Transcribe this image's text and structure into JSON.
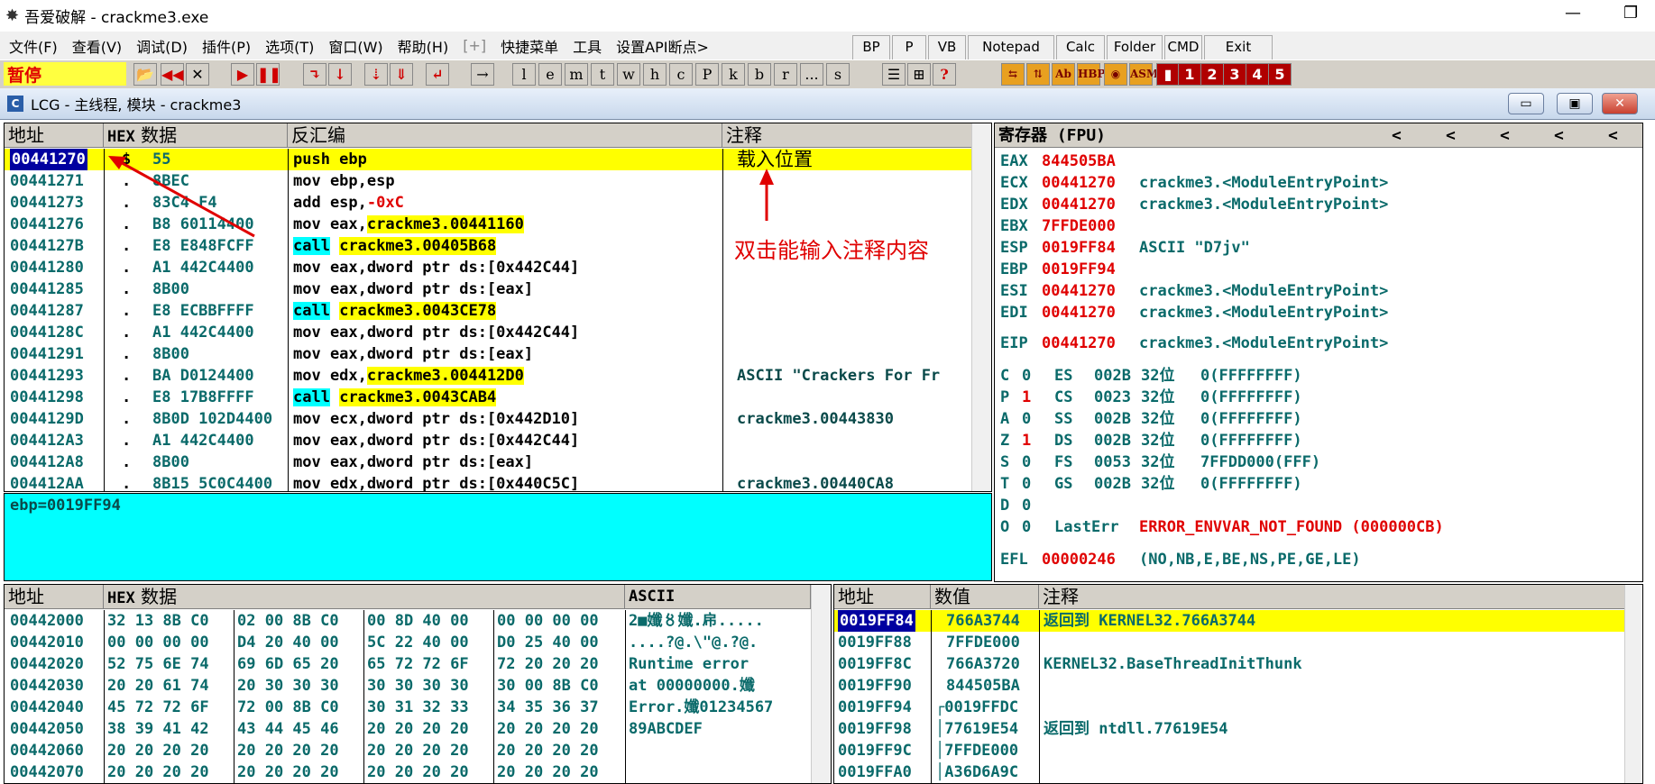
{
  "window": {
    "title": "吾爱破解 - crackme3.exe",
    "icon_name": "app-logo-icon",
    "min_label": "—",
    "restore_label": "❐"
  },
  "menu": {
    "items": [
      "文件(F)",
      "查看(V)",
      "调试(D)",
      "插件(P)",
      "选项(T)",
      "窗口(W)",
      "帮助(H)",
      "[+]",
      "快捷菜单",
      "工具",
      "设置API断点>"
    ],
    "buttons": [
      "BP",
      "P",
      "VB",
      "Notepad",
      "Calc",
      "Folder",
      "CMD",
      "Exit"
    ]
  },
  "toolbar": {
    "status": "暂停",
    "letters": [
      "l",
      "e",
      "m",
      "t",
      "w",
      "h",
      "c",
      "P",
      "k",
      "b",
      "r",
      "...",
      "s"
    ],
    "nums": [
      "1",
      "2",
      "3",
      "4",
      "5"
    ],
    "help": "?",
    "hbp": "HBP",
    "asm": "ASM"
  },
  "mdi": {
    "icon_letter": "C",
    "title": "LCG - 主线程, 模块 - crackme3",
    "min": "▭",
    "max": "▣",
    "close": "✕"
  },
  "cpu": {
    "headers": {
      "addr": "地址",
      "hex_prefix": "HEX",
      "hex": "数据",
      "disasm": "反汇编",
      "comment": "注释"
    },
    "rows": [
      {
        "addr": "00441270",
        "mark": "$",
        "hex": "55",
        "asm": "push ebp",
        "comment": "载入位置"
      },
      {
        "addr": "00441271",
        "mark": ".",
        "hex": "8BEC",
        "asm": "mov ebp,esp",
        "comment": ""
      },
      {
        "addr": "00441273",
        "mark": ".",
        "hex": "83C4 F4",
        "asm": "add esp,",
        "asm_hl": "-0xC",
        "comment": ""
      },
      {
        "addr": "00441276",
        "mark": ".",
        "hex": "B8 60114400",
        "asm": "mov eax,",
        "asm_hl": "crackme3.00441160",
        "comment": ""
      },
      {
        "addr": "0044127B",
        "mark": ".",
        "hex": "E8 E848FCFF",
        "asm": "call",
        "asm_hl": "crackme3.00405B68",
        "comment": ""
      },
      {
        "addr": "00441280",
        "mark": ".",
        "hex": "A1 442C4400",
        "asm": "mov eax,dword ptr ds:[0x442C44]",
        "comment": ""
      },
      {
        "addr": "00441285",
        "mark": ".",
        "hex": "8B00",
        "asm": "mov eax,dword ptr ds:[eax]",
        "comment": ""
      },
      {
        "addr": "00441287",
        "mark": ".",
        "hex": "E8 ECBBFFFF",
        "asm": "call",
        "asm_hl": "crackme3.0043CE78",
        "comment": ""
      },
      {
        "addr": "0044128C",
        "mark": ".",
        "hex": "A1 442C4400",
        "asm": "mov eax,dword ptr ds:[0x442C44]",
        "comment": ""
      },
      {
        "addr": "00441291",
        "mark": ".",
        "hex": "8B00",
        "asm": "mov eax,dword ptr ds:[eax]",
        "comment": ""
      },
      {
        "addr": "00441293",
        "mark": ".",
        "hex": "BA D0124400",
        "asm": "mov edx,",
        "asm_hl": "crackme3.004412D0",
        "comment": "ASCII \"Crackers For Fr"
      },
      {
        "addr": "00441298",
        "mark": ".",
        "hex": "E8 17B8FFFF",
        "asm": "call",
        "asm_hl": "crackme3.0043CAB4",
        "comment": ""
      },
      {
        "addr": "0044129D",
        "mark": ".",
        "hex": "8B0D 102D4400",
        "asm": "mov ecx,dword ptr ds:[0x442D10]",
        "comment": "crackme3.00443830"
      },
      {
        "addr": "004412A3",
        "mark": ".",
        "hex": "A1 442C4400",
        "asm": "mov eax,dword ptr ds:[0x442C44]",
        "comment": ""
      },
      {
        "addr": "004412A8",
        "mark": ".",
        "hex": "8B00",
        "asm": "mov eax,dword ptr ds:[eax]",
        "comment": ""
      },
      {
        "addr": "004412AA",
        "mark": ".",
        "hex": "8B15 5C0C4400",
        "asm": "mov edx,dword ptr ds:[0x440C5C]",
        "comment": "crackme3.00440CA8"
      }
    ],
    "annotation": "双击能输入注释内容"
  },
  "info": {
    "text": "ebp=0019FF94"
  },
  "registers": {
    "header": "寄存器 (FPU)",
    "arrows": [
      "<",
      "<",
      "<",
      "<",
      "<"
    ],
    "gp": [
      {
        "name": "EAX",
        "val": "844505BA",
        "desc": ""
      },
      {
        "name": "ECX",
        "val": "00441270",
        "desc": "crackme3.<ModuleEntryPoint>"
      },
      {
        "name": "EDX",
        "val": "00441270",
        "desc": "crackme3.<ModuleEntryPoint>"
      },
      {
        "name": "EBX",
        "val": "7FFDE000",
        "desc": ""
      },
      {
        "name": "ESP",
        "val": "0019FF84",
        "desc": "ASCII \"D7jv\""
      },
      {
        "name": "EBP",
        "val": "0019FF94",
        "desc": ""
      },
      {
        "name": "ESI",
        "val": "00441270",
        "desc": "crackme3.<ModuleEntryPoint>"
      },
      {
        "name": "EDI",
        "val": "00441270",
        "desc": "crackme3.<ModuleEntryPoint>"
      }
    ],
    "eip": {
      "name": "EIP",
      "val": "00441270",
      "desc": "crackme3.<ModuleEntryPoint>"
    },
    "flags": [
      {
        "f": "C",
        "v": "0",
        "seg": "ES",
        "sv": "002B",
        "bits": "32位",
        "rest": "0(FFFFFFFF)"
      },
      {
        "f": "P",
        "v": "1",
        "seg": "CS",
        "sv": "0023",
        "bits": "32位",
        "rest": "0(FFFFFFFF)"
      },
      {
        "f": "A",
        "v": "0",
        "seg": "SS",
        "sv": "002B",
        "bits": "32位",
        "rest": "0(FFFFFFFF)"
      },
      {
        "f": "Z",
        "v": "1",
        "seg": "DS",
        "sv": "002B",
        "bits": "32位",
        "rest": "0(FFFFFFFF)"
      },
      {
        "f": "S",
        "v": "0",
        "seg": "FS",
        "sv": "0053",
        "bits": "32位",
        "rest": "7FFDD000(FFF)"
      },
      {
        "f": "T",
        "v": "0",
        "seg": "GS",
        "sv": "002B",
        "bits": "32位",
        "rest": "0(FFFFFFFF)"
      },
      {
        "f": "D",
        "v": "0",
        "seg": "",
        "sv": "",
        "bits": "",
        "rest": ""
      }
    ],
    "o_line": {
      "f": "O",
      "v": "0",
      "label": "LastErr",
      "err": "ERROR_ENVVAR_NOT_FOUND (000000CB)"
    },
    "efl": {
      "name": "EFL",
      "val": "00000246",
      "desc": "(NO,NB,E,BE,NS,PE,GE,LE)"
    }
  },
  "dump": {
    "headers": {
      "addr": "地址",
      "hex_prefix": "HEX",
      "hex": "数据",
      "ascii": "ASCII"
    },
    "rows": [
      {
        "addr": "00442000",
        "g": [
          "32 13 8B C0",
          "02 00 8B C0",
          "00 8D 40 00",
          "00 00 00 00"
        ],
        "ascii": "2■孅〥孅.帍....."
      },
      {
        "addr": "00442010",
        "g": [
          "00 00 00 00",
          "D4 20 40 00",
          "5C 22 40 00",
          "D0 25 40 00"
        ],
        "ascii": "....?@.\\\"@.?@."
      },
      {
        "addr": "00442020",
        "g": [
          "52 75 6E 74",
          "69 6D 65 20",
          "65 72 72 6F",
          "72 20 20 20"
        ],
        "ascii": "Runtime error"
      },
      {
        "addr": "00442030",
        "g": [
          "20 20 61 74",
          "20 30 30 30",
          "30 30 30 30",
          "30 00 8B C0"
        ],
        "ascii": "  at 00000000.孅"
      },
      {
        "addr": "00442040",
        "g": [
          "45 72 72 6F",
          "72 00 8B C0",
          "30 31 32 33",
          "34 35 36 37"
        ],
        "ascii": "Error.孅01234567"
      },
      {
        "addr": "00442050",
        "g": [
          "38 39 41 42",
          "43 44 45 46",
          "20 20 20 20",
          "20 20 20 20"
        ],
        "ascii": "89ABCDEF"
      },
      {
        "addr": "00442060",
        "g": [
          "20 20 20 20",
          "20 20 20 20",
          "20 20 20 20",
          "20 20 20 20"
        ],
        "ascii": ""
      },
      {
        "addr": "00442070",
        "g": [
          "20 20 20 20",
          "20 20 20 20",
          "20 20 20 20",
          "20 20 20 20"
        ],
        "ascii": ""
      }
    ]
  },
  "stack": {
    "headers": {
      "addr": "地址",
      "val": "数值",
      "comment": "注释"
    },
    "rows": [
      {
        "addr": "0019FF84",
        "val": "766A3744",
        "comment": "返回到 KERNEL32.766A3744"
      },
      {
        "addr": "0019FF88",
        "val": "7FFDE000",
        "comment": ""
      },
      {
        "addr": "0019FF8C",
        "val": "766A3720",
        "comment": "KERNEL32.BaseThreadInitThunk"
      },
      {
        "addr": "0019FF90",
        "val": "844505BA",
        "comment": ""
      },
      {
        "addr": "0019FF94",
        "val": "┌0019FFDC",
        "comment": ""
      },
      {
        "addr": "0019FF98",
        "val": "│77619E54",
        "comment": "返回到 ntdll.77619E54"
      },
      {
        "addr": "0019FF9C",
        "val": "│7FFDE000",
        "comment": ""
      },
      {
        "addr": "0019FFA0",
        "val": "│A36D6A9C",
        "comment": ""
      }
    ]
  },
  "colors": {
    "accent_yellow": "#ffff00",
    "selection": "#0000a0",
    "info_bg": "#00ffff",
    "annotation": "#e00000"
  }
}
